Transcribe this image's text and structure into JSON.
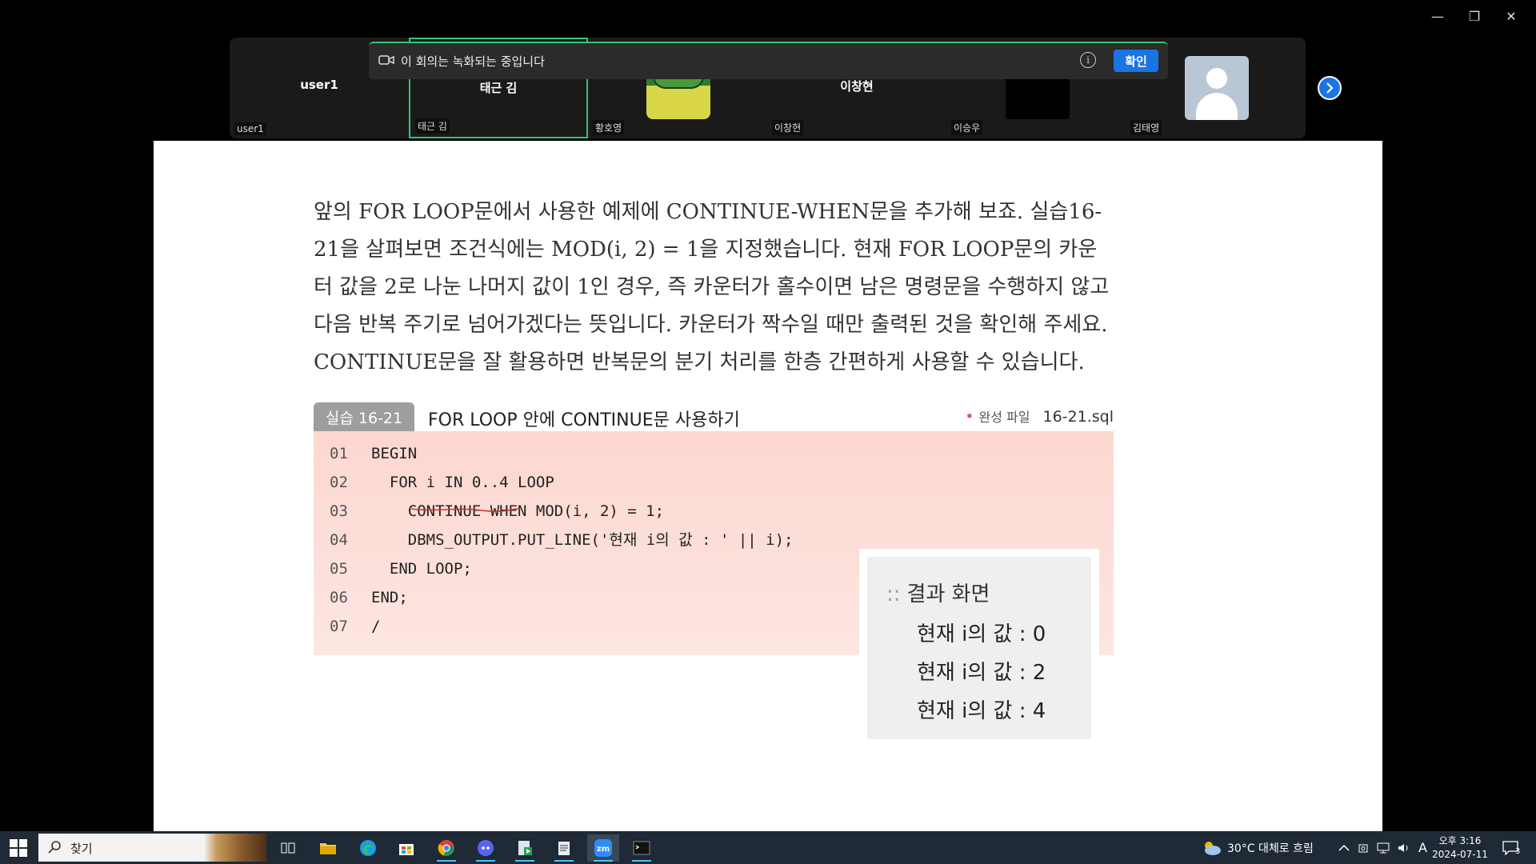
{
  "window": {
    "minimize": "—",
    "maximize": "❐",
    "close": "✕"
  },
  "participants": [
    {
      "display": "user1",
      "label": "user1",
      "active": false
    },
    {
      "display": "태근 김",
      "label": "태근 김",
      "active": true
    },
    {
      "display": "",
      "label": "황호영",
      "active": false
    },
    {
      "display": "이창현",
      "label": "이창현",
      "active": false
    },
    {
      "display": "",
      "label": "이승우",
      "active": false
    },
    {
      "display": "",
      "label": "김태영",
      "active": false
    }
  ],
  "banner": {
    "text": "이 회의는 녹화되는 중입니다",
    "info": "i",
    "ok_label": "확인"
  },
  "document": {
    "paragraph": "앞의 FOR LOOP문에서 사용한 예제에 CONTINUE-WHEN문을 추가해 보죠. 실습16-21을 살펴보면 조건식에는 MOD(i, 2) = 1을 지정했습니다. 현재 FOR LOOP문의 카운터 값을 2로 나눈 나머지 값이 1인 경우, 즉 카운터가 홀수이면 남은 명령문을 수행하지 않고 다음 반복 주기로 넘어가겠다는 뜻입니다. 카운터가 짝수일 때만 출력된 것을 확인해 주세요. CONTINUE문을 잘 활용하면 반복문의 분기 처리를 한층 간편하게 사용할 수 있습니다.",
    "example_tag": "실습 16-21",
    "example_title": "FOR LOOP 안에 CONTINUE문 사용하기",
    "file_bullet": "•",
    "file_label": "완성 파일",
    "file_name": "16-21.sql",
    "code": [
      {
        "num": "01",
        "text": "BEGIN"
      },
      {
        "num": "02",
        "text": "  FOR i IN 0..4 LOOP"
      },
      {
        "num": "03",
        "text": "    CONTINUE WHEN MOD(i, 2) = 1;"
      },
      {
        "num": "04",
        "text": "    DBMS_OUTPUT.PUT_LINE('현재 i의 값 : ' || i);"
      },
      {
        "num": "05",
        "text": "  END LOOP;"
      },
      {
        "num": "06",
        "text": "END;"
      },
      {
        "num": "07",
        "text": "/"
      }
    ],
    "result_colon": "::",
    "result_title": "결과 화면",
    "results": [
      "현재 i의 값 : 0",
      "현재 i의 값 : 2",
      "현재 i의 값 : 4"
    ]
  },
  "taskbar": {
    "search_placeholder": "찾기",
    "apps": [
      "task-view",
      "file-explorer",
      "edge",
      "store",
      "chrome",
      "discord",
      "media",
      "notepad",
      "zoom",
      "terminal"
    ],
    "weather": "30°C 대체로 흐림",
    "input_indicator": "A",
    "time": "오후 3:16",
    "date": "2024-07-11",
    "notification_count": "3"
  },
  "colors": {
    "accent": "#1b74e4",
    "active_speaker": "#33c477",
    "code_bg": "#fcd7d0"
  }
}
